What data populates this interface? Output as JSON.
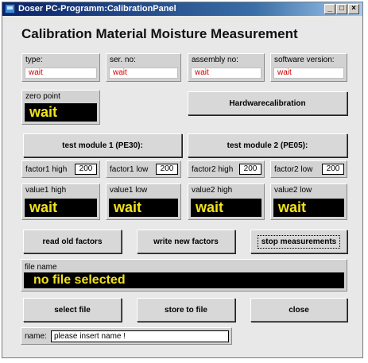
{
  "window": {
    "title": "Doser PC-Programm:CalibrationPanel",
    "min": "_",
    "max": "□",
    "close": "×"
  },
  "heading": "Calibration Material Moisture Measurement",
  "info": {
    "type": {
      "label": "type:",
      "value": "wait"
    },
    "serno": {
      "label": "ser. no:",
      "value": "wait"
    },
    "assembly": {
      "label": "assembly no:",
      "value": "wait"
    },
    "software": {
      "label": "software version:",
      "value": "wait"
    }
  },
  "zero_point": {
    "label": "zero point",
    "value": "wait"
  },
  "buttons": {
    "hardware": "Hardwarecalibration",
    "module1": "test module 1 (PE30):",
    "module2": "test module 2 (PE05):",
    "read": "read old factors",
    "write": "write new factors",
    "stop": "stop measurements",
    "select": "select file",
    "store": "store to file",
    "close": "close"
  },
  "factors": {
    "f1high": {
      "label": "factor1 high",
      "value": "200"
    },
    "f1low": {
      "label": "factor1 low",
      "value": "200"
    },
    "f2high": {
      "label": "factor2 high",
      "value": "200"
    },
    "f2low": {
      "label": "factor2 low",
      "value": "200"
    }
  },
  "values": {
    "v1high": {
      "label": "value1 high",
      "value": "wait"
    },
    "v1low": {
      "label": "value1 low",
      "value": "wait"
    },
    "v2high": {
      "label": "value2 high",
      "value": "wait"
    },
    "v2low": {
      "label": "value2 low",
      "value": "wait"
    }
  },
  "file": {
    "label": "file name",
    "value": "no file selected"
  },
  "name": {
    "label": "name:",
    "value": "please insert name !"
  }
}
